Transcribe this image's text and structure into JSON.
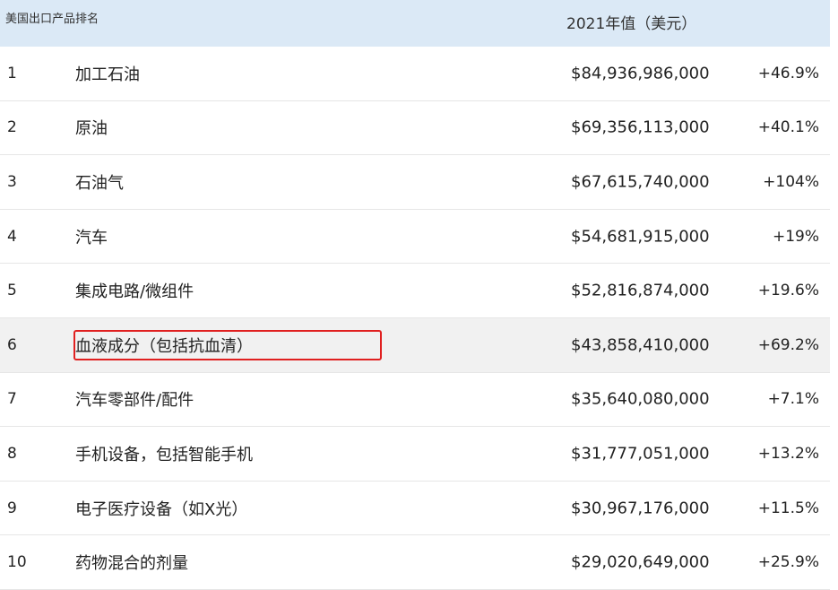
{
  "header": {
    "label": "美国出口产品排名",
    "value_label": "2021年值（美元）"
  },
  "colors": {
    "header_bg": "#dbe9f6",
    "highlight_row_bg": "#f1f1f1",
    "annotation_box": "#e02020"
  },
  "highlighted_rank": 6,
  "rows": [
    {
      "rank": "1",
      "name": "加工石油",
      "value": "$84,936,986,000",
      "change": "+46.9%"
    },
    {
      "rank": "2",
      "name": "原油",
      "value": "$69,356,113,000",
      "change": "+40.1%"
    },
    {
      "rank": "3",
      "name": "石油气",
      "value": "$67,615,740,000",
      "change": "+104%"
    },
    {
      "rank": "4",
      "name": "汽车",
      "value": "$54,681,915,000",
      "change": "+19%"
    },
    {
      "rank": "5",
      "name": "集成电路/微组件",
      "value": "$52,816,874,000",
      "change": "+19.6%"
    },
    {
      "rank": "6",
      "name": "血液成分（包括抗血清）",
      "value": "$43,858,410,000",
      "change": "+69.2%"
    },
    {
      "rank": "7",
      "name": "汽车零部件/配件",
      "value": "$35,640,080,000",
      "change": "+7.1%"
    },
    {
      "rank": "8",
      "name": "手机设备，包括智能手机",
      "value": "$31,777,051,000",
      "change": "+13.2%"
    },
    {
      "rank": "9",
      "name": "电子医疗设备（如X光）",
      "value": "$30,967,176,000",
      "change": "+11.5%"
    },
    {
      "rank": "10",
      "name": "药物混合的剂量",
      "value": "$29,020,649,000",
      "change": "+25.9%"
    }
  ]
}
